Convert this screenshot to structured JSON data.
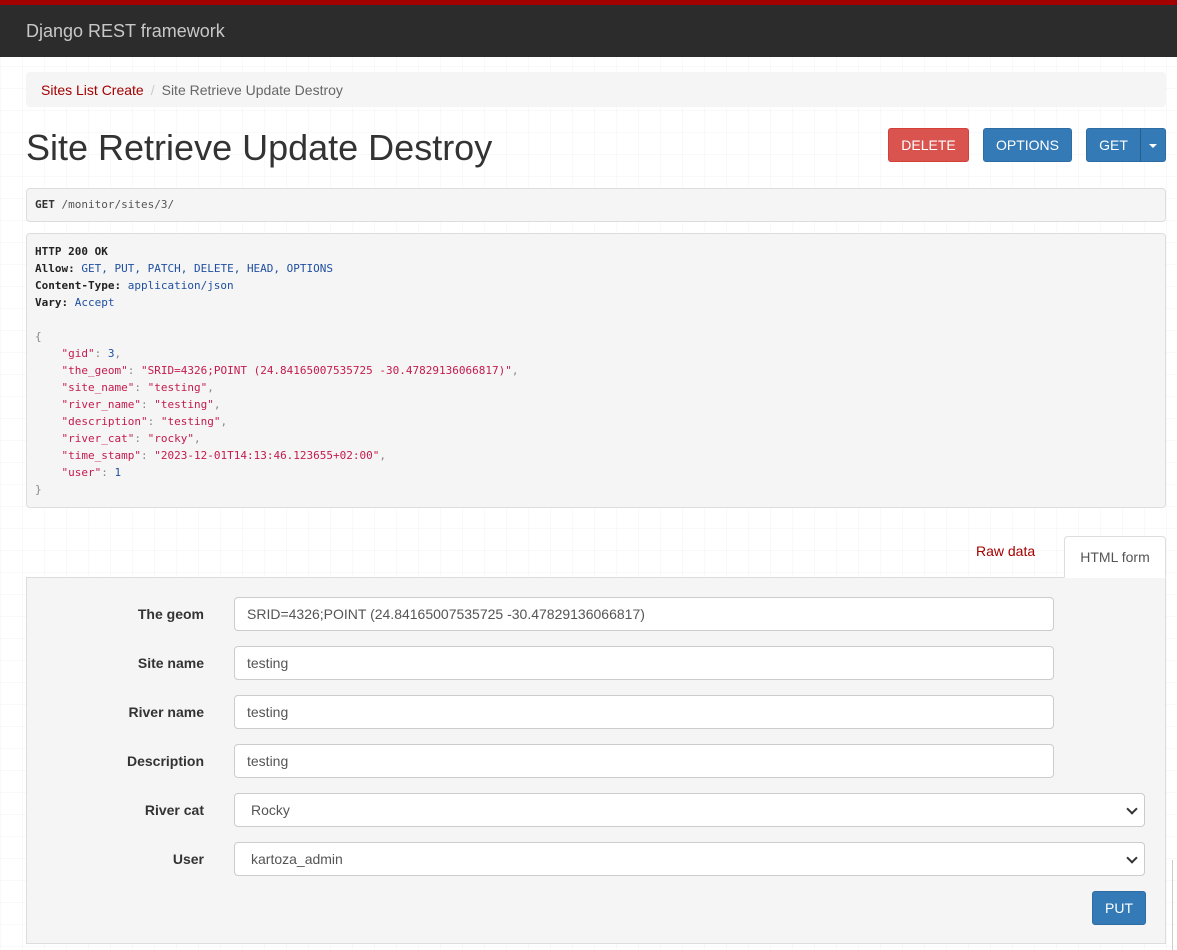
{
  "navbar": {
    "brand": "Django REST framework"
  },
  "breadcrumb": {
    "parent": "Sites List Create",
    "current": "Site Retrieve Update Destroy"
  },
  "page": {
    "title": "Site Retrieve Update Destroy"
  },
  "actions": {
    "delete": "DELETE",
    "options": "OPTIONS",
    "get": "GET"
  },
  "request": {
    "method": "GET",
    "path": "/monitor/sites/3/"
  },
  "response": {
    "status": "HTTP 200 OK",
    "headers": [
      {
        "name": "Allow:",
        "value": "GET, PUT, PATCH, DELETE, HEAD, OPTIONS"
      },
      {
        "name": "Content-Type:",
        "value": "application/json"
      },
      {
        "name": "Vary:",
        "value": "Accept"
      }
    ],
    "open_brace": "{",
    "close_brace": "}",
    "body": [
      {
        "key": "\"gid\"",
        "value": "3",
        "type": "number",
        "comma": ","
      },
      {
        "key": "\"the_geom\"",
        "value": "\"SRID=4326;POINT (24.84165007535725 -30.47829136066817)\"",
        "type": "string",
        "comma": ","
      },
      {
        "key": "\"site_name\"",
        "value": "\"testing\"",
        "type": "string",
        "comma": ","
      },
      {
        "key": "\"river_name\"",
        "value": "\"testing\"",
        "type": "string",
        "comma": ","
      },
      {
        "key": "\"description\"",
        "value": "\"testing\"",
        "type": "string",
        "comma": ","
      },
      {
        "key": "\"river_cat\"",
        "value": "\"rocky\"",
        "type": "string",
        "comma": ","
      },
      {
        "key": "\"time_stamp\"",
        "value": "\"2023-12-01T14:13:46.123655+02:00\"",
        "type": "string",
        "comma": ","
      },
      {
        "key": "\"user\"",
        "value": "1",
        "type": "number",
        "comma": ""
      }
    ]
  },
  "tabs": {
    "raw": "Raw data",
    "html": "HTML form"
  },
  "form": {
    "the_geom": {
      "label": "The geom",
      "value": "SRID=4326;POINT (24.84165007535725 -30.47829136066817)"
    },
    "site_name": {
      "label": "Site name",
      "value": "testing"
    },
    "river_name": {
      "label": "River name",
      "value": "testing"
    },
    "description": {
      "label": "Description",
      "value": "testing"
    },
    "river_cat": {
      "label": "River cat",
      "selected": "Rocky"
    },
    "user": {
      "label": "User",
      "selected": "kartoza_admin"
    },
    "submit": "PUT"
  },
  "colors": {
    "navbar": "#2c2c2c",
    "accent": "#a30000",
    "primary": "#337ab7",
    "danger": "#d9534f"
  }
}
